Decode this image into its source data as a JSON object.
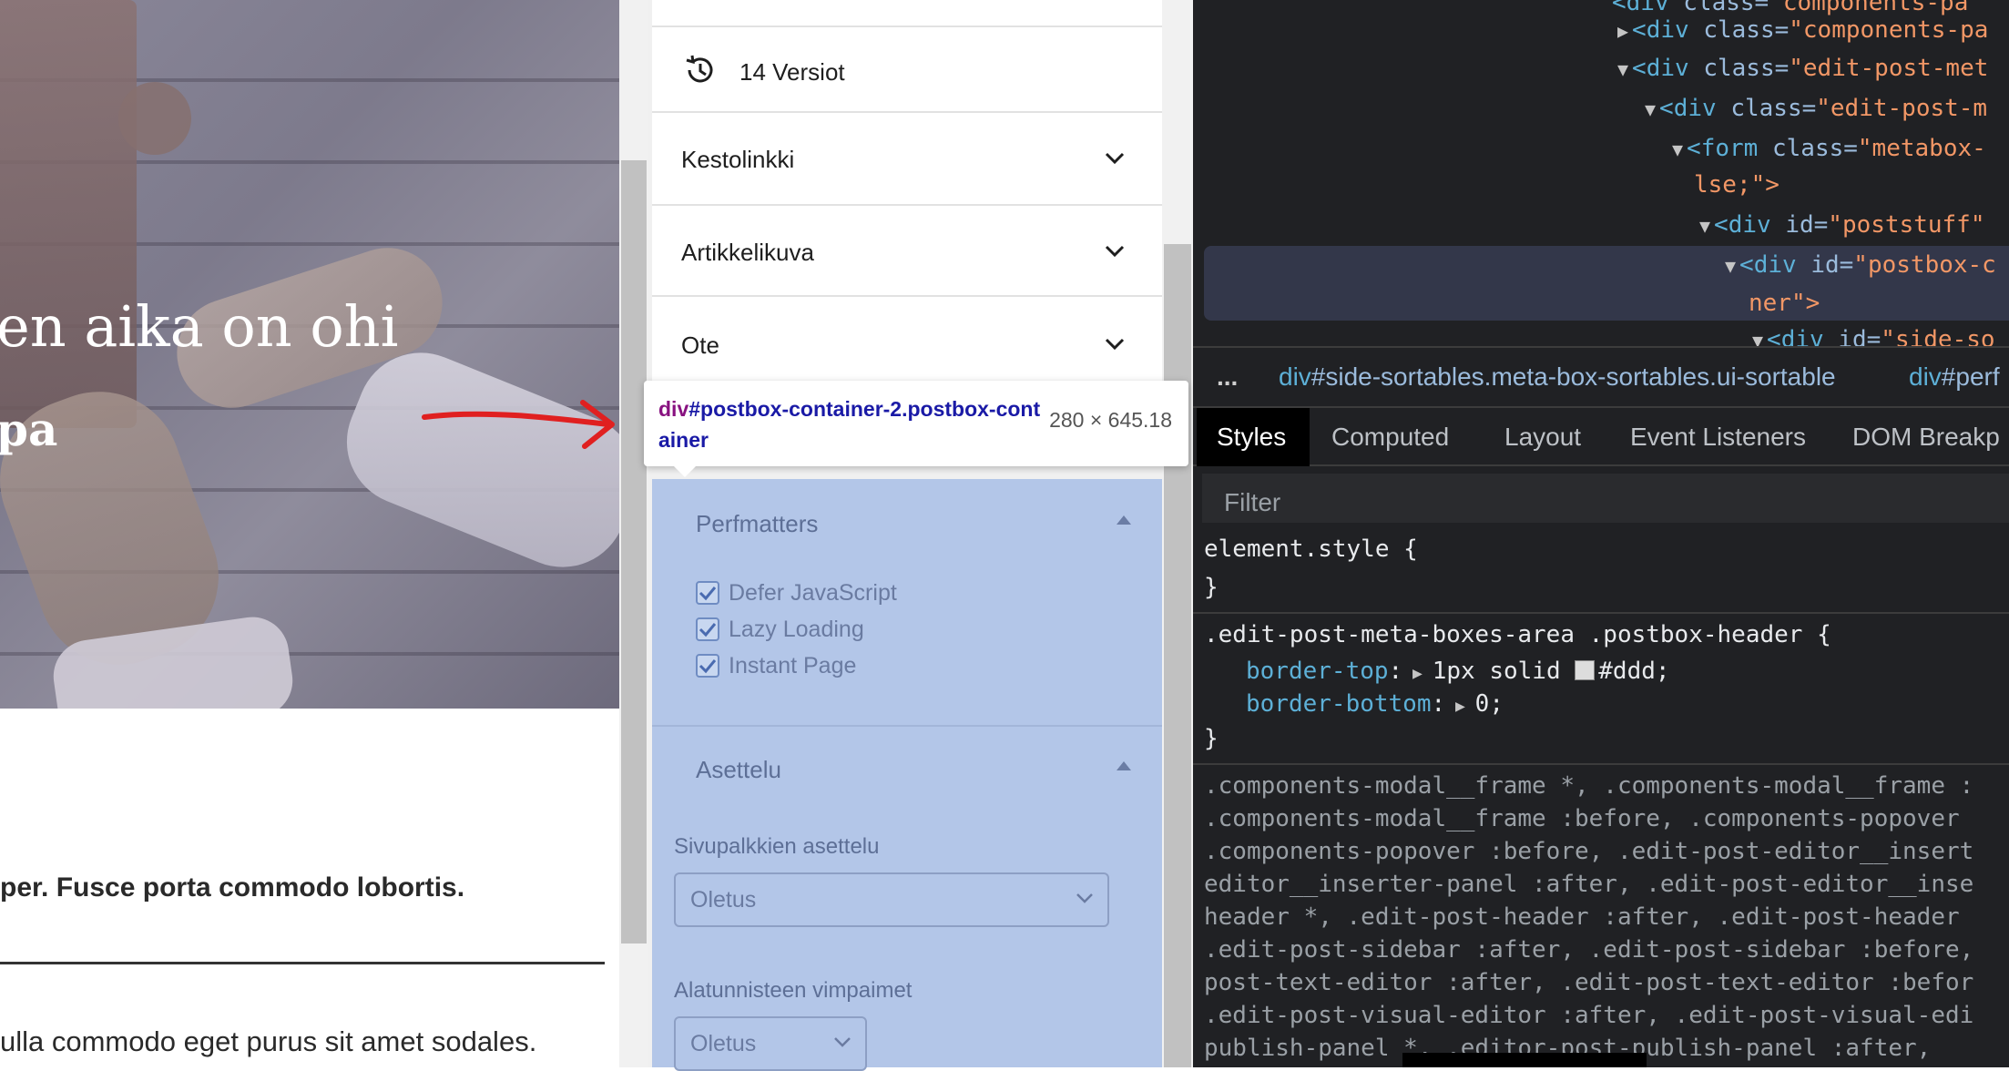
{
  "editor": {
    "hero_title": "en aika on ohi",
    "hero_subtitle": "pa",
    "paragraph_1": "per. Fusce porta commodo lobortis.",
    "paragraph_2": "ulla commodo eget purus sit amet sodales."
  },
  "sidebar": {
    "revisions_label": "14 Versiot",
    "panels": [
      {
        "label": "Kestolinkki"
      },
      {
        "label": "Artikkelikuva"
      },
      {
        "label": "Ote"
      }
    ],
    "perfmatters": {
      "title": "Perfmatters",
      "options": [
        {
          "label": "Defer JavaScript",
          "checked": true
        },
        {
          "label": "Lazy Loading",
          "checked": true
        },
        {
          "label": "Instant Page",
          "checked": true
        }
      ]
    },
    "asettelu": {
      "title": "Asettelu",
      "sidebar_layout_label": "Sivupalkkien asettelu",
      "sidebar_layout_value": "Oletus",
      "footer_widgets_label": "Alatunnisteen vimpaimet",
      "footer_widgets_value": "Oletus"
    }
  },
  "tooltip": {
    "selector_tag": "div",
    "selector_rest": "#postbox-container-2.postbox-container",
    "size": "280 × 645.18"
  },
  "devtools": {
    "dom": [
      {
        "open": "<",
        "tag": "div",
        "attr": " class=",
        "val": "\"components-pa"
      },
      {
        "tag": "div",
        "attr": " class=",
        "val": "\"edit-post-met"
      },
      {
        "tag": "div",
        "attr": " class=",
        "val": "\"edit-post-m"
      },
      {
        "tag": "form",
        "attr": " class=",
        "val": "\"metabox-"
      },
      {
        "text": "lse;\">"
      },
      {
        "tag": "div",
        "attr": " id=",
        "val": "\"poststuff\""
      },
      {
        "tag": "div",
        "attr": " id=",
        "val": "\"postbox-c"
      },
      {
        "text": "ner\">"
      },
      {
        "tag": "div",
        "attr": " id=",
        "val": "\"side-so"
      }
    ],
    "breadcrumb_dots": "...",
    "breadcrumbs": [
      {
        "tag": "div",
        "rest": "#side-sortables.meta-box-sortables.ui-sortable"
      },
      {
        "tag": "div",
        "rest": "#perf"
      }
    ],
    "tabs": [
      "Styles",
      "Computed",
      "Layout",
      "Event Listeners",
      "DOM Breakp"
    ],
    "filter_placeholder": "Filter",
    "element_style": "element.style {",
    "close_brace": "}",
    "rule_selector": ".edit-post-meta-boxes-area .postbox-header {",
    "rule_props": [
      {
        "name": "border-top",
        "value": "1px solid",
        "color": "#ddd",
        "suffix": "#ddd;"
      },
      {
        "name": "border-bottom",
        "value": "0;"
      }
    ],
    "dim_lines": [
      ".components-modal__frame *, .components-modal__frame :",
      ".components-modal__frame :before, .components-popover",
      ".components-popover :before, .edit-post-editor__insert",
      "editor__inserter-panel :after, .edit-post-editor__inse",
      "header *, .edit-post-header :after, .edit-post-header",
      ".edit-post-sidebar :after, .edit-post-sidebar :before,",
      "post-text-editor :after, .edit-post-text-editor :befor",
      ".edit-post-visual-editor :after, .edit-post-visual-edi",
      "publish-panel *, .editor-post-publish-panel :after,"
    ]
  },
  "colors": {
    "highlight": "#b3c6e8",
    "devtools_bg": "#202124",
    "annotation_arrow": "#e02020"
  }
}
